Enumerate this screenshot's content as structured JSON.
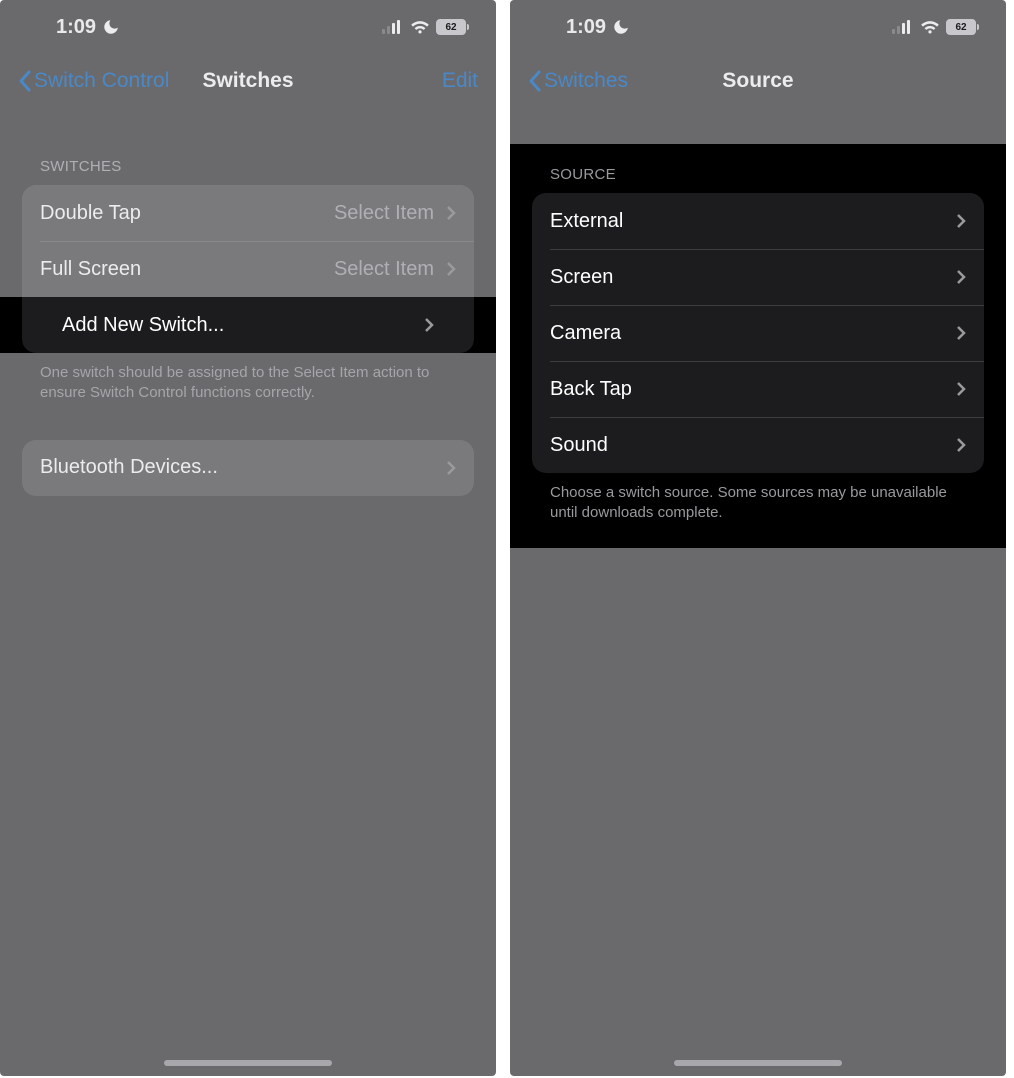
{
  "status": {
    "time": "1:09",
    "battery": "62"
  },
  "panel1": {
    "nav": {
      "back": "Switch Control",
      "title": "Switches",
      "edit": "Edit"
    },
    "section_header": "SWITCHES",
    "rows": [
      {
        "label": "Double Tap",
        "value": "Select Item"
      },
      {
        "label": "Full Screen",
        "value": "Select Item"
      }
    ],
    "add_row": "Add New Switch...",
    "footer": "One switch should be assigned to the Select Item action to ensure Switch Control functions correctly.",
    "bluetooth": "Bluetooth Devices..."
  },
  "panel2": {
    "nav": {
      "back": "Switches",
      "title": "Source"
    },
    "section_header": "SOURCE",
    "rows": [
      {
        "label": "External"
      },
      {
        "label": "Screen"
      },
      {
        "label": "Camera"
      },
      {
        "label": "Back Tap"
      },
      {
        "label": "Sound"
      }
    ],
    "footer": "Choose a switch source. Some sources may be unavailable until downloads complete."
  }
}
